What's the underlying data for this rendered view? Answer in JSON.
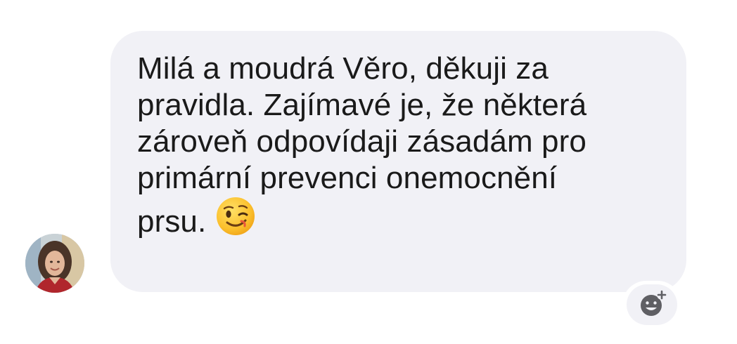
{
  "message": {
    "text": "Milá a moudrá Věro, děkuji za\npravidla. Zajímavé je, že některá\nzároveň odpovídaji zásadám pro\nprimární prevenci onemocnění\nprsu.",
    "emoji": "winking-face",
    "bubble_color": "#f1f1f6",
    "text_color": "#1a1a1a"
  },
  "sender": {
    "avatar": "profile-photo"
  },
  "reaction_button": {
    "icon": "add-reaction-icon"
  }
}
